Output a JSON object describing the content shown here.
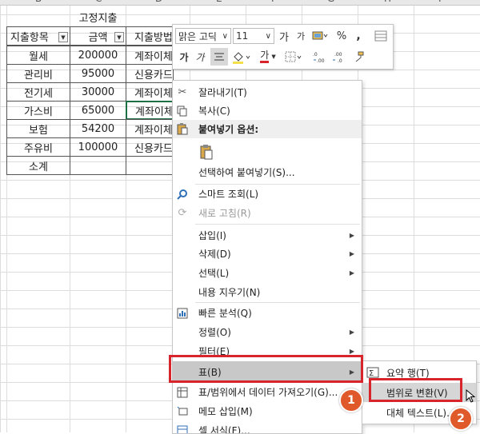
{
  "sheet": {
    "column_headers": [
      "B",
      "C",
      "D",
      "E",
      "F",
      "G",
      "H",
      "I"
    ],
    "table_title": "고정지출",
    "headers": [
      "지출항목",
      "금액",
      "지출방법"
    ],
    "rows": [
      {
        "item": "월세",
        "amount": "200000",
        "method": "계좌이체"
      },
      {
        "item": "관리비",
        "amount": "95000",
        "method": "신용카드"
      },
      {
        "item": "전기세",
        "amount": "30000",
        "method": "계좌이체"
      },
      {
        "item": "가스비",
        "amount": "65000",
        "method": "계좌이체"
      },
      {
        "item": "보험",
        "amount": "54200",
        "method": "계좌이체"
      },
      {
        "item": "주유비",
        "amount": "100000",
        "method": "신용카드"
      },
      {
        "item": "소계",
        "amount": "",
        "method": ""
      }
    ]
  },
  "mini_toolbar": {
    "font_name": "맑은 고딕",
    "font_size": "11",
    "grow_font": "가",
    "shrink_font": "가",
    "percent": "%",
    "comma": ",",
    "bold": "가",
    "italic": "가",
    "font_color_letter": "가"
  },
  "context_menu": {
    "items": [
      {
        "label": "잘라내기(T)",
        "icon": "scissors-icon"
      },
      {
        "label": "복사(C)",
        "icon": "copy-icon"
      },
      {
        "label": "붙여넣기 옵션:",
        "icon": "paste-icon"
      },
      {
        "label": "",
        "icon": "clipboard-icon"
      },
      {
        "label": "선택하여 붙여넣기(S)...",
        "icon": ""
      },
      {
        "label": "스마트 조회(L)",
        "icon": "search-icon"
      },
      {
        "label": "새로 고침(R)",
        "icon": "refresh-icon"
      },
      {
        "label": "삽입(I)",
        "icon": ""
      },
      {
        "label": "삭제(D)",
        "icon": ""
      },
      {
        "label": "선택(L)",
        "icon": ""
      },
      {
        "label": "내용 지우기(N)",
        "icon": ""
      },
      {
        "label": "빠른 분석(Q)",
        "icon": "quick-analysis-icon"
      },
      {
        "label": "정렬(O)",
        "icon": ""
      },
      {
        "label": "필터(E)",
        "icon": ""
      },
      {
        "label": "표(B)",
        "icon": ""
      },
      {
        "label": "표/범위에서 데이터 가져오기(G)...",
        "icon": "table-import-icon"
      },
      {
        "label": "메모 삽입(M)",
        "icon": "comment-icon"
      },
      {
        "label": "셀 서식(F)...",
        "icon": "format-cells-icon"
      }
    ]
  },
  "submenu": {
    "items": [
      {
        "label": "요약 행(T)",
        "icon": "sum-icon"
      },
      {
        "label": "범위로 변환(V)",
        "icon": ""
      },
      {
        "label": "대체 텍스트(L)...",
        "icon": ""
      }
    ]
  },
  "badges": {
    "first": "1",
    "second": "2"
  },
  "colors": {
    "highlight_red": "#d8252c",
    "badge_orange": "#e0592b",
    "hover_gray": "#c8c8c8"
  }
}
